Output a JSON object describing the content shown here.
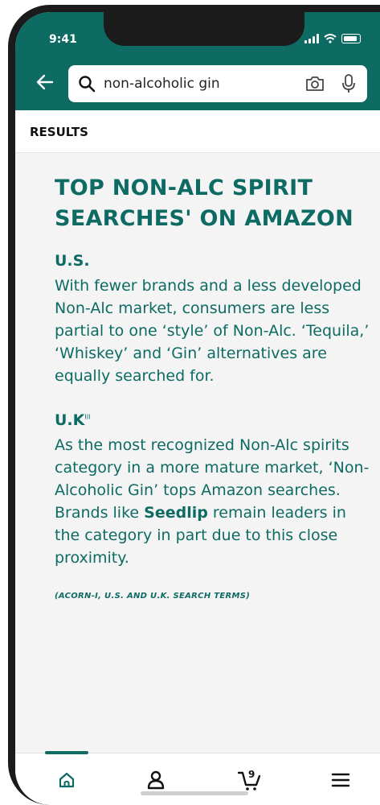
{
  "status": {
    "time": "9:41"
  },
  "search": {
    "query": "non-alcoholic gin"
  },
  "results_label": "RESULTS",
  "article": {
    "title_line1": "TOP NON-ALC SPIRIT",
    "title_line2": "SEARCHES' ON AMAZON",
    "us_heading": "U.S.",
    "us_text": "With fewer brands and a less developed Non-Alc market, consumers are less partial to one ‘style’ of Non-Alc. ‘Tequila,’ ‘Whiskey’ and ‘Gin’ alternatives are equally searched for.",
    "uk_heading": "U.K",
    "uk_heading_mark": "III",
    "uk_text_before": "As the most recognized Non-Alc spirits category in a more mature market, ‘Non-Alcoholic Gin’ tops Amazon searches. Brands like ",
    "uk_brand": "Seedlip",
    "uk_text_after": " remain leaders in the category in part due to this close proximity.",
    "source": "(ACORN-I, U.S. AND U.K. SEARCH TERMS)"
  },
  "tabbar": {
    "cart_count": "9",
    "active_tab": "home"
  },
  "colors": {
    "accent": "#0d6b63",
    "background": "#f4f4f4"
  }
}
